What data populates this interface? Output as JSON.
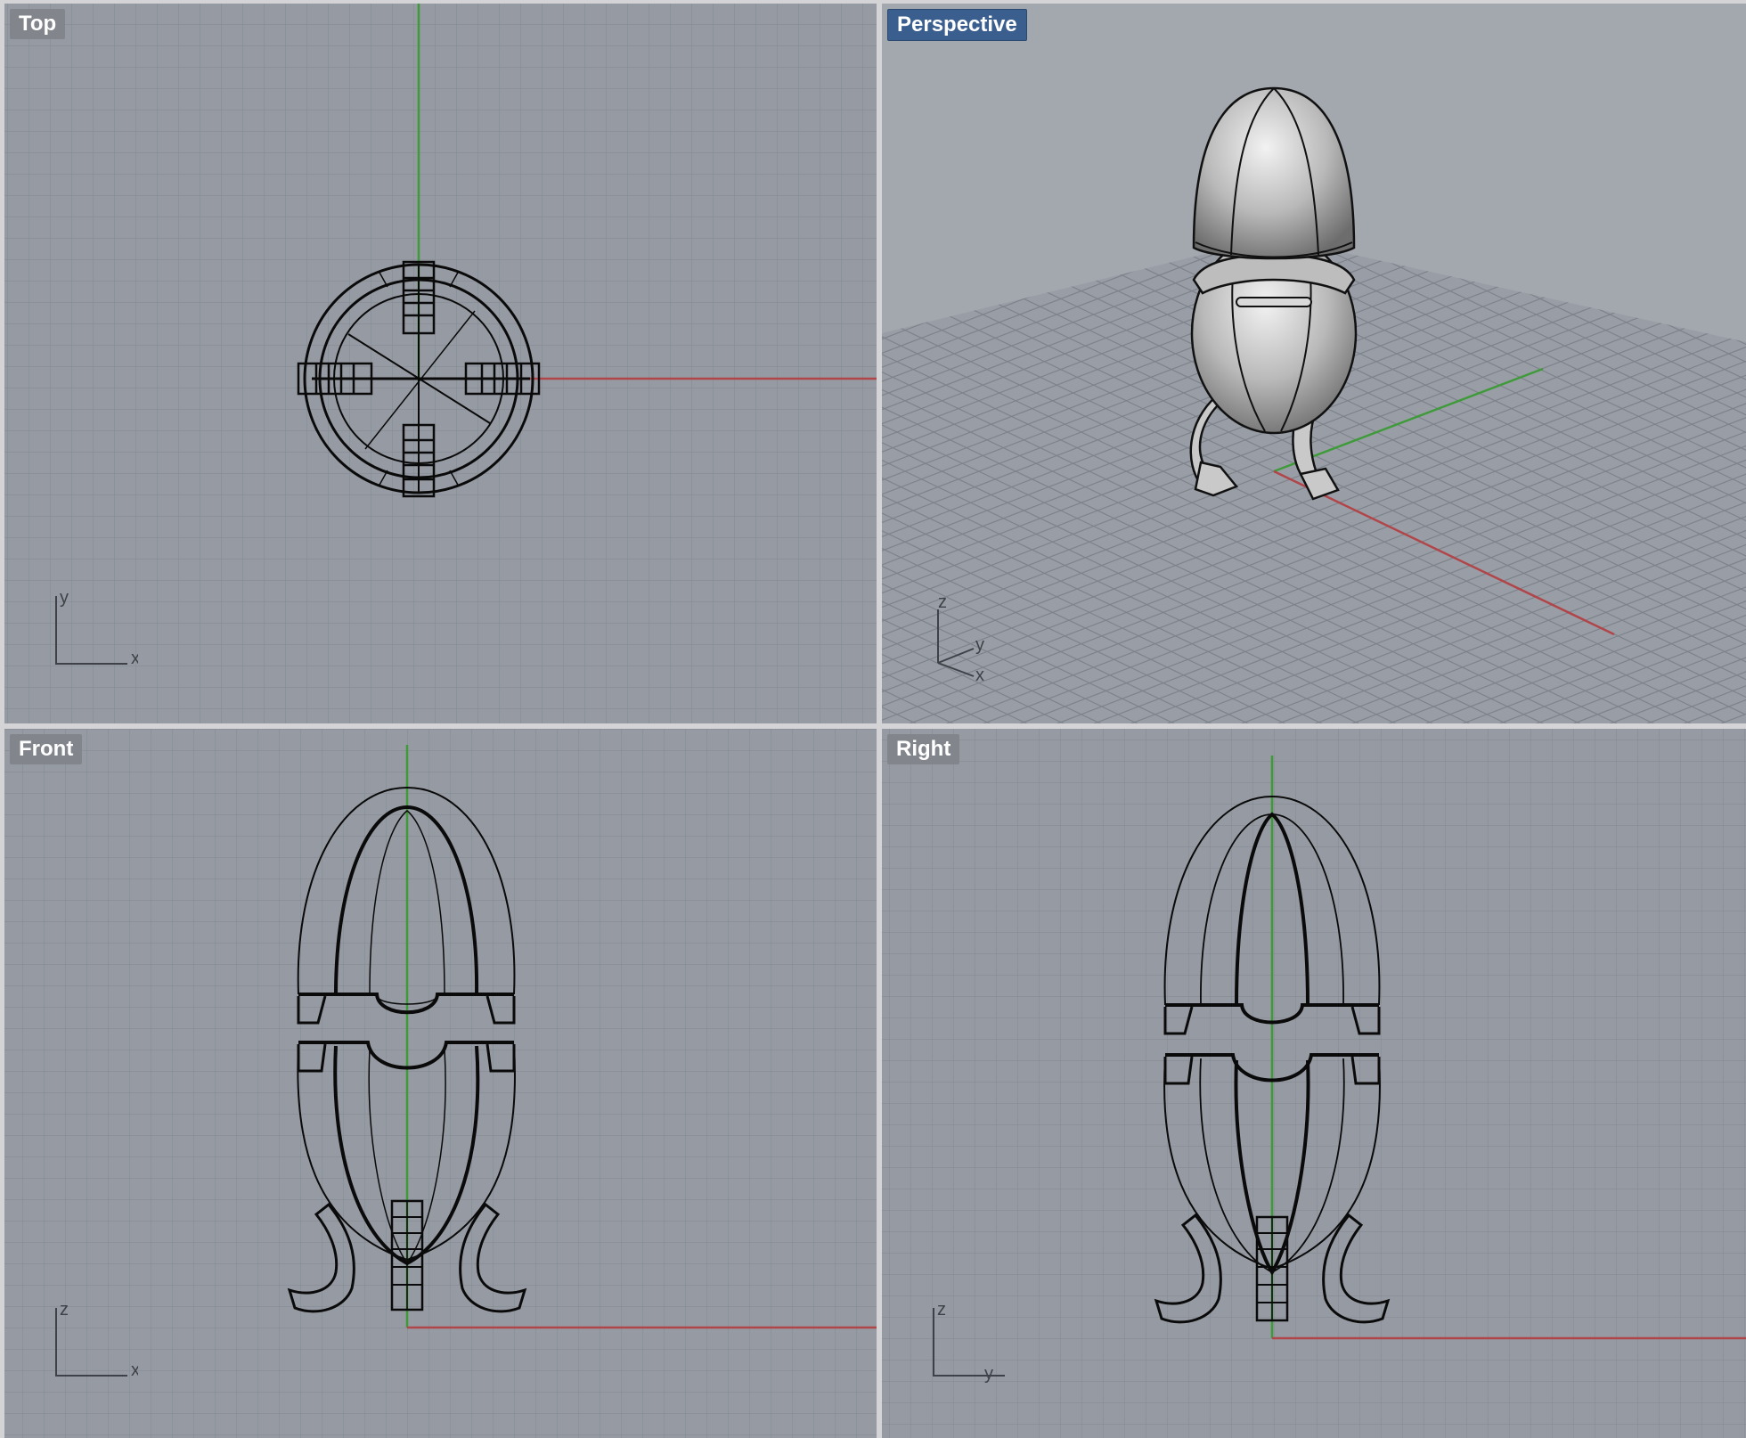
{
  "viewports": {
    "top": {
      "label": "Top",
      "axis_labels": [
        "x",
        "y"
      ]
    },
    "perspective": {
      "label": "Perspective",
      "active": true,
      "axis_labels": [
        "z",
        "y",
        "x"
      ]
    },
    "front": {
      "label": "Front",
      "axis_labels": [
        "x",
        "z"
      ]
    },
    "right": {
      "label": "Right",
      "axis_labels": [
        "y",
        "z"
      ]
    }
  },
  "colors": {
    "viewport_bg": "#969ba3",
    "grid_minor": "#868b93",
    "grid_major": "#7b8088",
    "x_axis": "#b0464a",
    "y_axis": "#3f9a3a",
    "active_tab": "#3a5f8f",
    "wire": "#0a0a0a"
  },
  "icons": [
    "axis-triad-icon"
  ]
}
